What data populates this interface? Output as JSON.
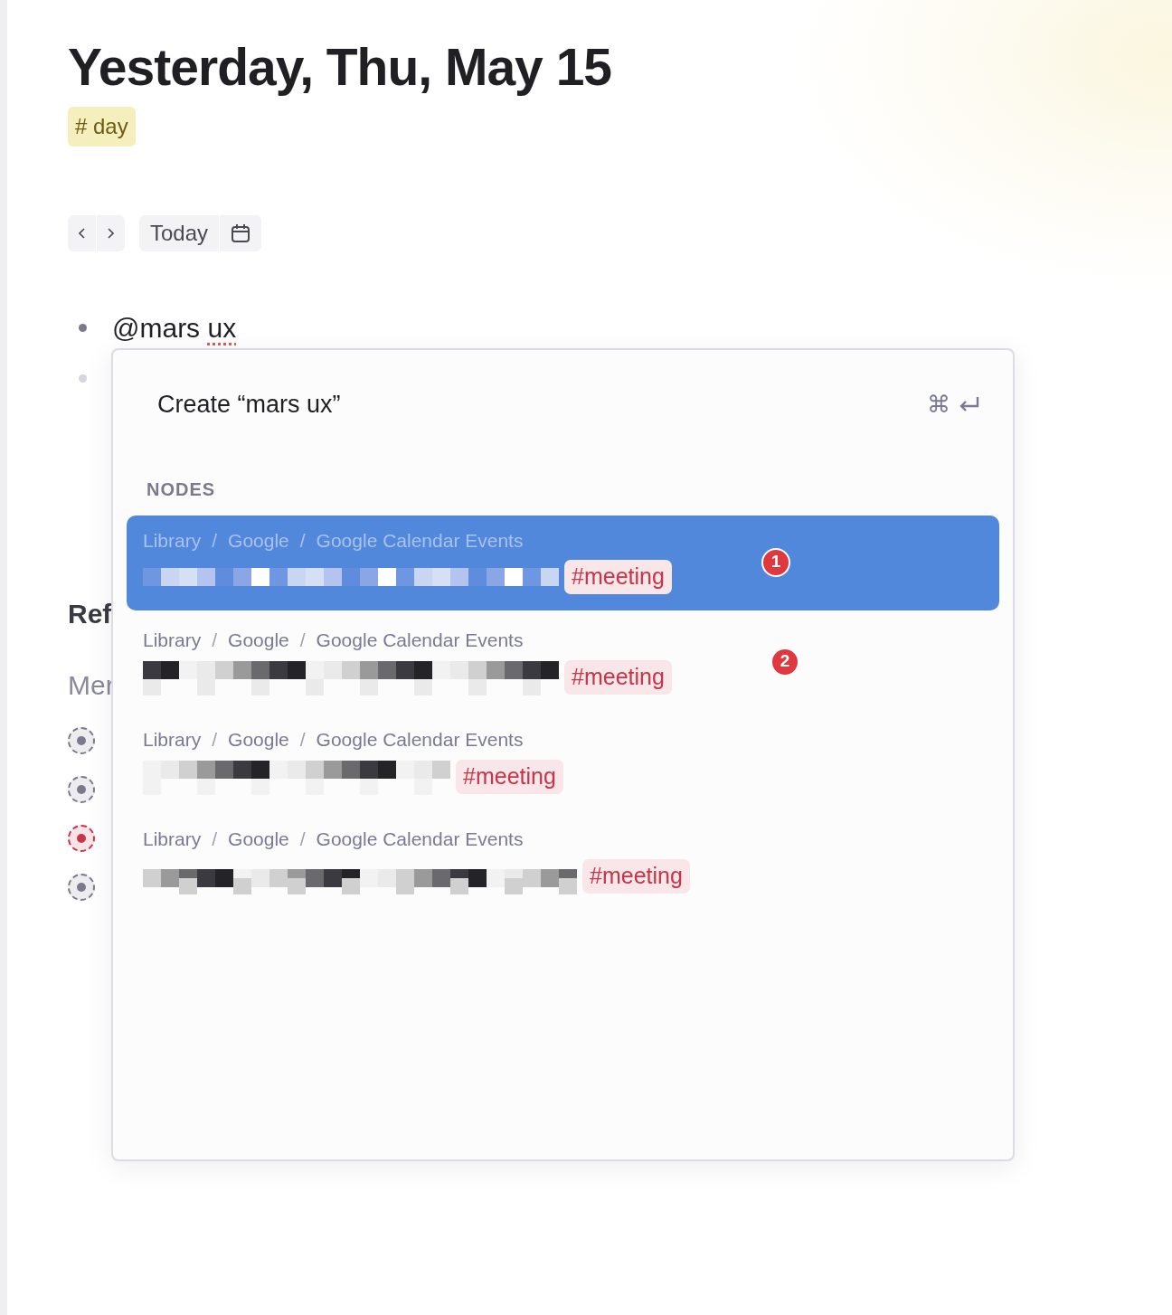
{
  "title": "Yesterday, Thu, May 15",
  "tag": "# day",
  "nav": {
    "today": "Today"
  },
  "bullets": [
    {
      "text": "@mars ux"
    },
    {
      "kind": "empty"
    }
  ],
  "references": {
    "heading": "Ref",
    "subheading": "Mer",
    "items": [
      {
        "color": "#7a7a8c"
      },
      {
        "color": "#7a7a8c"
      },
      {
        "color": "#c8344a"
      },
      {
        "color": "#7a7a8c"
      }
    ]
  },
  "popup": {
    "create_label": "Create “mars ux”",
    "shortcut": "⌘",
    "section": "NODES",
    "separator": "/",
    "nodes": [
      {
        "path": [
          "Library",
          "Google",
          "Google Calendar Events"
        ],
        "tag": "#meeting",
        "selected": true,
        "badge": "1"
      },
      {
        "path": [
          "Library",
          "Google",
          "Google Calendar Events"
        ],
        "tag": "#meeting",
        "selected": false,
        "badge": "2"
      },
      {
        "path": [
          "Library",
          "Google",
          "Google Calendar Events"
        ],
        "tag": "#meeting",
        "selected": false
      },
      {
        "path": [
          "Library",
          "Google",
          "Google Calendar Events"
        ],
        "tag": "#meeting",
        "selected": false
      }
    ]
  }
}
